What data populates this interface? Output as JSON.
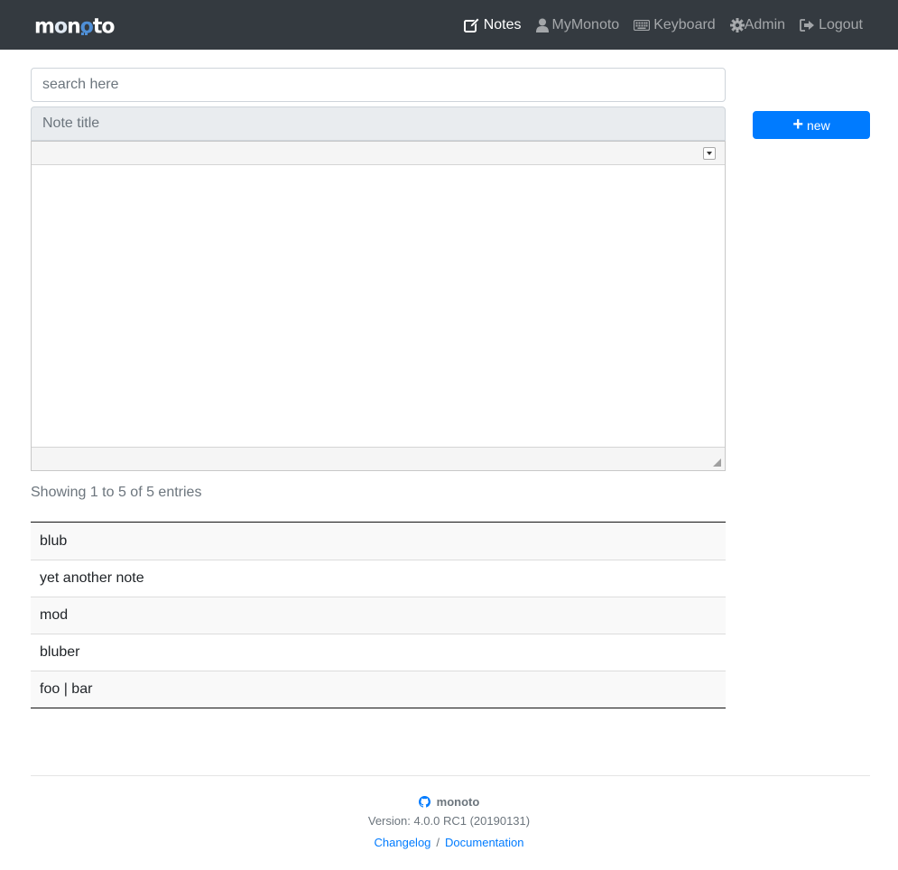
{
  "navbar": {
    "brand": "monoto",
    "items": [
      {
        "label": "Notes",
        "icon": "edit-icon",
        "active": true
      },
      {
        "label": "MyMonoto",
        "icon": "user-icon",
        "active": false
      },
      {
        "label": "Keyboard",
        "icon": "keyboard-icon",
        "active": false
      },
      {
        "label": "Admin",
        "icon": "gear-icon",
        "active": false
      },
      {
        "label": "Logout",
        "icon": "logout-icon",
        "active": false
      }
    ]
  },
  "search": {
    "placeholder": "search here",
    "value": ""
  },
  "note_title": {
    "placeholder": "Note title",
    "value": ""
  },
  "editor": {
    "content": ""
  },
  "toolbar": {
    "new_label": "new"
  },
  "table": {
    "info": "Showing 1 to 5 of 5 entries",
    "rows": [
      "blub",
      "yet another note",
      "mod",
      "bluber",
      "foo | bar"
    ]
  },
  "footer": {
    "brand": "monoto",
    "version": "Version: 4.0.0 RC1 (20190131)",
    "changelog": "Changelog",
    "separator": "/",
    "documentation": "Documentation"
  },
  "colors": {
    "navbar": "#343a40",
    "primary": "#007bff",
    "muted": "#6c757d"
  }
}
